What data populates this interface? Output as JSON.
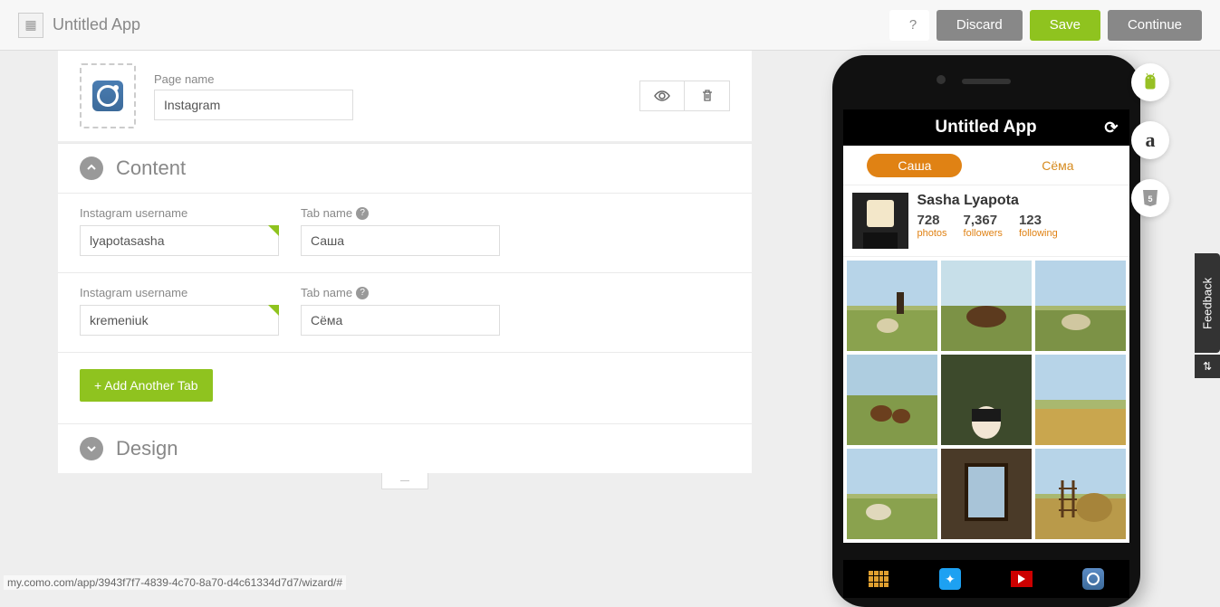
{
  "header": {
    "app_title": "Untitled App",
    "help": "?",
    "discard": "Discard",
    "save": "Save",
    "continue": "Continue"
  },
  "page": {
    "name_label": "Page name",
    "name_value": "Instagram"
  },
  "sections": {
    "content_title": "Content",
    "design_title": "Design"
  },
  "fields": {
    "username_label": "Instagram username",
    "tabname_label": "Tab name"
  },
  "tabs": [
    {
      "username": "lyapotasasha",
      "tabname": "Саша"
    },
    {
      "username": "kremeniuk",
      "tabname": "Сёма"
    }
  ],
  "add_button": "+  Add Another Tab",
  "preview": {
    "app_title": "Untitled App",
    "pills": [
      "Саша",
      "Сёма"
    ],
    "profile_name": "Sasha Lyapota",
    "stats": [
      {
        "num": "728",
        "lbl": "photos"
      },
      {
        "num": "7,367",
        "lbl": "followers"
      },
      {
        "num": "123",
        "lbl": "following"
      }
    ]
  },
  "platforms": {
    "amazon": "a"
  },
  "feedback": "Feedback",
  "status_url": "my.como.com/app/3943f7f7-4839-4c70-8a70-d4c61334d7d7/wizard/#"
}
